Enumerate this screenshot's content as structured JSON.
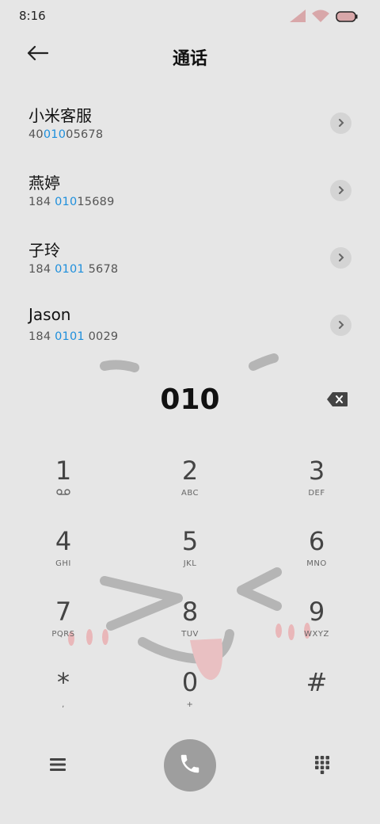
{
  "status_bar": {
    "time": "8:16"
  },
  "header": {
    "title": "通话"
  },
  "contacts": [
    {
      "name": "小米客服",
      "num_pre": "40",
      "num_hl": "010",
      "num_post": "05678"
    },
    {
      "name": "燕婷",
      "num_pre": "184 ",
      "num_hl": "010",
      "num_post": "15689"
    },
    {
      "name": "子玲",
      "num_pre": "184 ",
      "num_hl": "0101",
      "num_post": " 5678"
    },
    {
      "name": "Jason",
      "num_pre": "184 ",
      "num_hl": "0101",
      "num_post": " 0029"
    }
  ],
  "dialer": {
    "typed_number": "010"
  },
  "keypad": [
    {
      "digit": "1",
      "letters": ""
    },
    {
      "digit": "2",
      "letters": "ABC"
    },
    {
      "digit": "3",
      "letters": "DEF"
    },
    {
      "digit": "4",
      "letters": "GHI"
    },
    {
      "digit": "5",
      "letters": "JKL"
    },
    {
      "digit": "6",
      "letters": "MNO"
    },
    {
      "digit": "7",
      "letters": "PQRS"
    },
    {
      "digit": "8",
      "letters": "TUV"
    },
    {
      "digit": "9",
      "letters": "WXYZ"
    },
    {
      "digit": "*",
      "letters": ","
    },
    {
      "digit": "0",
      "letters": "+"
    },
    {
      "digit": "#",
      "letters": ""
    }
  ],
  "colors": {
    "highlight": "#1e8fdc",
    "call_button": "#9e9e9e",
    "background": "#e6e6e6"
  },
  "icons": [
    "signal-icon",
    "wifi-icon",
    "battery-icon",
    "back-arrow-icon",
    "chevron-right-icon",
    "backspace-icon",
    "voicemail-icon",
    "menu-icon",
    "phone-icon",
    "dialpad-icon"
  ]
}
